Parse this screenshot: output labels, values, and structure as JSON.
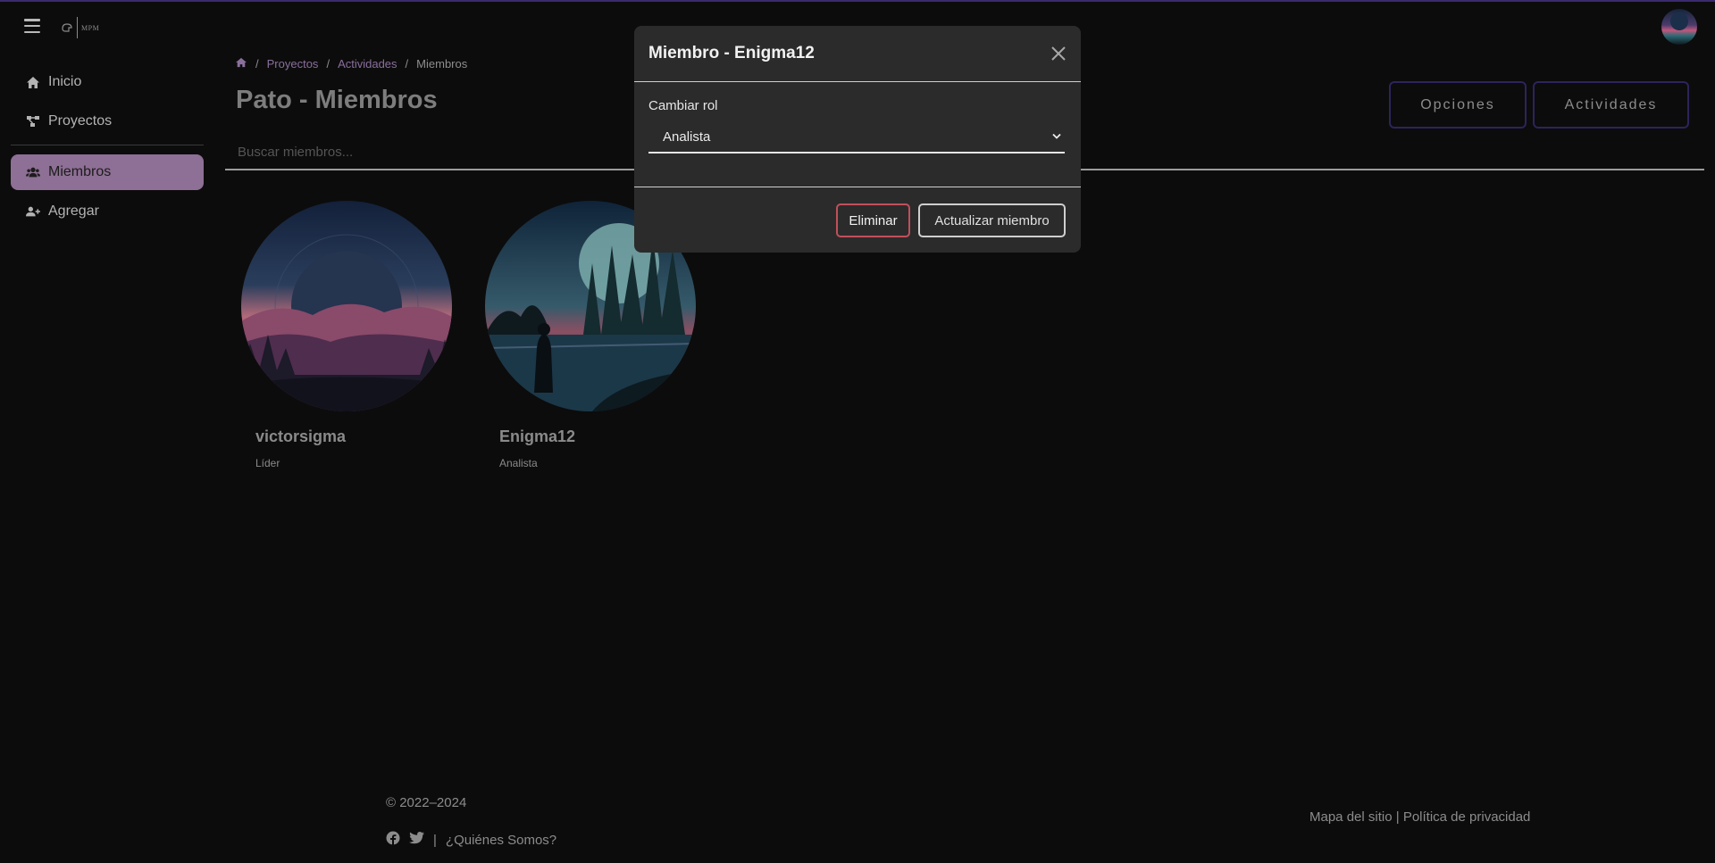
{
  "header": {
    "logo_text": "MPM"
  },
  "sidebar": {
    "items": [
      {
        "label": "Inicio",
        "icon": "home-icon"
      },
      {
        "label": "Proyectos",
        "icon": "project-diagram-icon"
      },
      {
        "label": "Miembros",
        "icon": "users-icon",
        "active": true
      },
      {
        "label": "Agregar",
        "icon": "user-plus-icon"
      }
    ]
  },
  "breadcrumb": {
    "items": [
      "Proyectos",
      "Actividades",
      "Miembros"
    ],
    "separator": "/"
  },
  "page": {
    "title": "Pato - Miembros",
    "options_button": "Opciones",
    "activities_button": "Actividades",
    "search_placeholder": "Buscar miembros..."
  },
  "members": [
    {
      "name": "victorsigma",
      "role": "Líder"
    },
    {
      "name": "Enigma12",
      "role": "Analista"
    }
  ],
  "modal": {
    "title": "Miembro - Enigma12",
    "role_label": "Cambiar rol",
    "role_value": "Analista",
    "delete_button": "Eliminar",
    "update_button": "Actualizar miembro"
  },
  "footer": {
    "copyright": "© 2022–2024",
    "separator": "|",
    "about": "¿Quiénes Somos?",
    "sitemap": "Mapa del sitio",
    "links_separator": "|",
    "privacy": "Política de privacidad"
  },
  "colors": {
    "background": "#0c0c0c",
    "accent_active": "#8e6f95",
    "breadcrumb_link": "#8a6f9c",
    "modal_bg": "#2b2b2b",
    "danger": "#c0505b"
  }
}
